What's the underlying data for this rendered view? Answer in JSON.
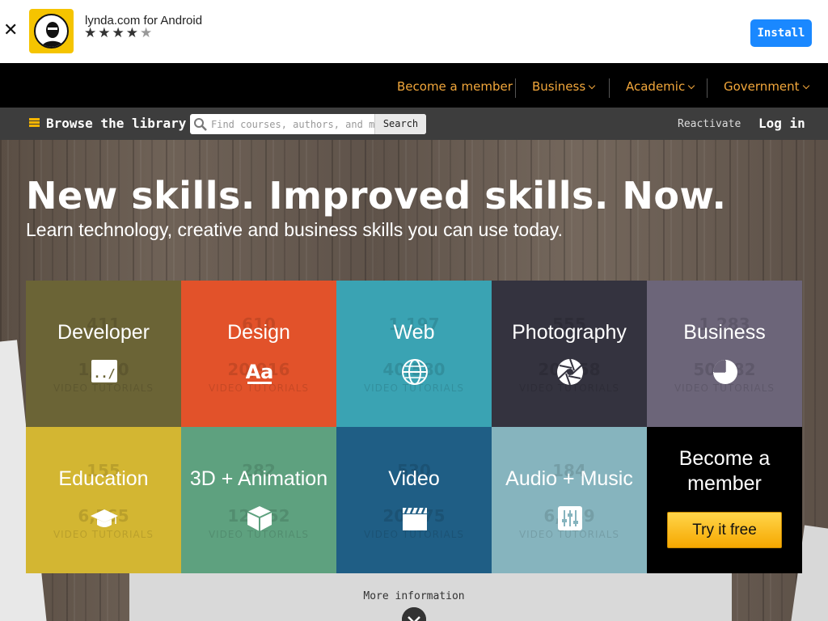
{
  "banner": {
    "close_glyph": "✕",
    "app_name": "lynda.com for Android",
    "rating_stars": 4.5,
    "stars_text": "★★★★",
    "half_star_text": "★",
    "install_label": "Install"
  },
  "topnav": {
    "items": [
      {
        "label": "Become a member"
      },
      {
        "label": "Business"
      },
      {
        "label": "Academic"
      },
      {
        "label": "Government"
      }
    ],
    "text_color": "#f2a73b"
  },
  "subbar": {
    "browse_label": "Browse the library",
    "search_placeholder": "Find courses, authors, and more",
    "search_button": "Search",
    "reactivate_label": "Reactivate",
    "login_label": "Log in"
  },
  "hero": {
    "headline": "New skills. Improved skills. Now.",
    "tagline": "Learn technology, creative and business skills you can use today."
  },
  "categories": [
    {
      "label": "Developer",
      "count": "411",
      "num": "1,050",
      "unit": "VIDEO TUTORIALS",
      "icon": "code-icon",
      "color": "#6b6436"
    },
    {
      "label": "Design",
      "count": "610",
      "num": "20,916",
      "unit": "VIDEO TUTORIALS",
      "icon": "typography-icon",
      "color": "#e2522a"
    },
    {
      "label": "Web",
      "count": "1,197",
      "num": "40,580",
      "unit": "VIDEO TUTORIALS",
      "icon": "globe-icon",
      "color": "#3aa3b3"
    },
    {
      "label": "Photography",
      "count": "555",
      "num": "20,858",
      "unit": "VIDEO TUTORIALS",
      "icon": "aperture-icon",
      "color": "#34333f"
    },
    {
      "label": "Business",
      "count": "1,283",
      "num": "50,582",
      "unit": "VIDEO TUTORIALS",
      "icon": "pie-chart-icon",
      "color": "#6c6579"
    },
    {
      "label": "Education",
      "count": "155",
      "num": "6,565",
      "unit": "VIDEO TUTORIALS",
      "icon": "graduation-cap-icon",
      "color": "#d3b632"
    },
    {
      "label": "3D + Animation",
      "count": "282",
      "num": "12,552",
      "unit": "VIDEO TUTORIALS",
      "icon": "cube-icon",
      "color": "#5ea17f"
    },
    {
      "label": "Video",
      "count": "530",
      "num": "20,475",
      "unit": "VIDEO TUTORIALS",
      "icon": "clapperboard-icon",
      "color": "#1f5e85"
    },
    {
      "label": "Audio + Music",
      "count": "184",
      "num": "6,559",
      "unit": "VIDEO TUTORIALS",
      "icon": "mixer-icon",
      "color": "#86b4be"
    }
  ],
  "member_tile": {
    "title_line1": "Become a",
    "title_line2": "member",
    "cta_label": "Try it free"
  },
  "more_info_label": "More information"
}
